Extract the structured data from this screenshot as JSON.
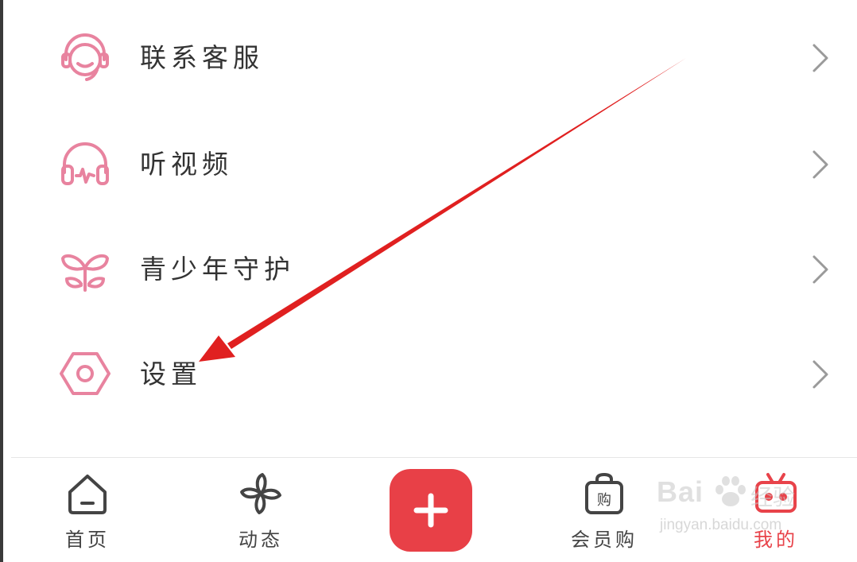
{
  "menu": {
    "items": [
      {
        "label": "联系客服",
        "icon": "headset-icon"
      },
      {
        "label": "听视频",
        "icon": "headphones-icon"
      },
      {
        "label": "青少年守护",
        "icon": "sprout-icon"
      },
      {
        "label": "设置",
        "icon": "settings-hexagon-icon"
      }
    ]
  },
  "tabbar": {
    "tabs": [
      {
        "label": "首页",
        "icon": "home-icon"
      },
      {
        "label": "动态",
        "icon": "pinwheel-icon"
      },
      {
        "label": "会员购",
        "icon": "shopping-bag-icon"
      },
      {
        "label": "我的",
        "icon": "tv-icon",
        "active": true
      }
    ],
    "add_symbol": "+"
  },
  "watermark": {
    "brand": "Bai",
    "suffix": "经验",
    "url": "jingyan.baidu.com"
  },
  "colors": {
    "icon_pink": "#e8839f",
    "accent_red": "#e84047",
    "annotation_arrow": "#e02020"
  }
}
